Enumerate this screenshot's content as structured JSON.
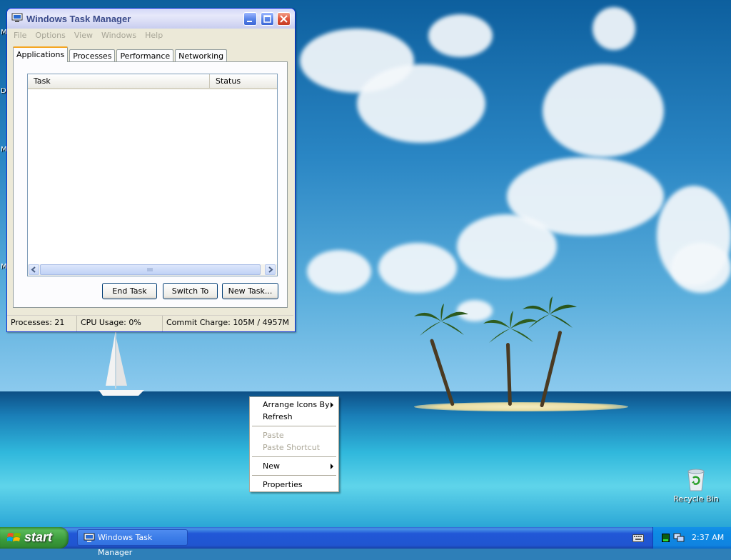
{
  "window": {
    "title": "Windows Task Manager",
    "menu": [
      "File",
      "Options",
      "View",
      "Windows",
      "Help"
    ],
    "tabs": [
      "Applications",
      "Processes",
      "Performance",
      "Networking"
    ],
    "active_tab": "Applications",
    "columns": [
      "Task",
      "Status"
    ],
    "buttons": {
      "end_task": "End Task",
      "switch_to": "Switch To",
      "new_task": "New Task..."
    },
    "status": {
      "processes": "Processes: 21",
      "cpu": "CPU Usage: 0%",
      "commit": "Commit Charge: 105M / 4957M"
    }
  },
  "context_menu": {
    "items": [
      {
        "label": "Arrange Icons By",
        "submenu": true,
        "disabled": false
      },
      {
        "label": "Refresh",
        "submenu": false,
        "disabled": false
      },
      {
        "label": "Paste",
        "submenu": false,
        "disabled": true
      },
      {
        "label": "Paste Shortcut",
        "submenu": false,
        "disabled": true
      },
      {
        "label": "New",
        "submenu": true,
        "disabled": false
      },
      {
        "label": "Properties",
        "submenu": false,
        "disabled": false
      }
    ]
  },
  "desktop": {
    "recycle_bin_label": "Recycle Bin",
    "edge_letters": [
      "M",
      "D",
      "M",
      "M"
    ]
  },
  "taskbar": {
    "start_label": "start",
    "task_button_label": "Windows Task Manager",
    "clock": "2:37 AM"
  },
  "colors": {
    "title_text": "#3a4a8a",
    "taskbar_blue": "#2157d7",
    "start_green": "#3a9a3a",
    "tab_accent": "#f5a623"
  }
}
